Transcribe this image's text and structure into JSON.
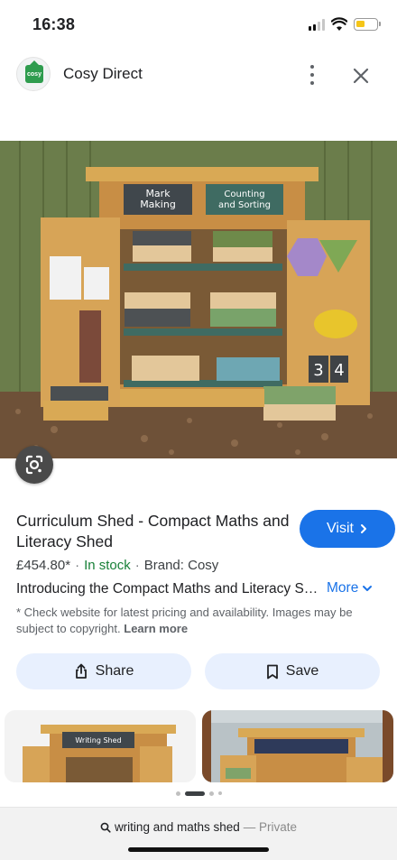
{
  "status_bar": {
    "time": "16:38",
    "battery_color": "#f5c518"
  },
  "header": {
    "site_name": "Cosy Direct",
    "logo_text": "cosy",
    "logo_color": "#2e9c4e",
    "menu_icon": "more-vert-icon",
    "close_icon": "close-icon"
  },
  "hero": {
    "sign_left": "Mark Making",
    "sign_right": "Counting and Sorting",
    "number_tiles": [
      "3",
      "4"
    ],
    "lens_icon": "google-lens-icon"
  },
  "product": {
    "title": "Curriculum Shed - Compact Maths and Literacy Shed",
    "price": "£454.80*",
    "stock": "In stock",
    "brand": "Brand: Cosy",
    "description": "Introducing the Compact Maths and Literacy Shed...",
    "more_label": "More",
    "disclaimer": "* Check website for latest pricing and availability. Images may be subject to copyright.",
    "learn_more": "Learn more",
    "stock_color": "#188038"
  },
  "actions": {
    "visit_label": "Visit",
    "share_label": "Share",
    "save_label": "Save",
    "accent": "#1a73e8"
  },
  "related": {
    "thumb1_sign": "Writing Shed"
  },
  "pagination": {
    "count": 4,
    "active_index": 1
  },
  "browser": {
    "address_query": "writing and maths shed",
    "address_mode": "— Private"
  }
}
